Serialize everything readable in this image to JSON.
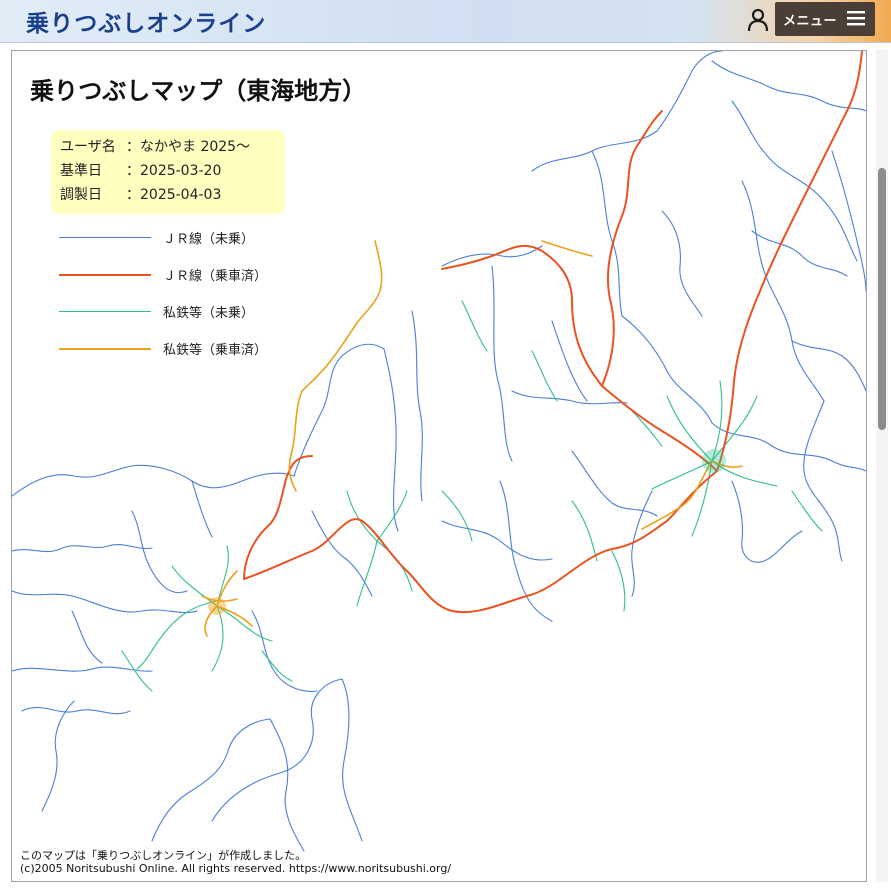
{
  "header": {
    "site_title": "乗りつぶしオンライン",
    "menu_label": "メニュー",
    "user_icon": "user-icon",
    "menu_icon": "hamburger-icon"
  },
  "map": {
    "title": "乗りつぶしマップ（東海地方）",
    "info": {
      "user_key": "ユーザ名",
      "user_value": "：なかやま 2025～",
      "base_key": "基準日",
      "base_value": "：2025-03-20",
      "made_key": "調製日",
      "made_value": "：2025-04-03"
    },
    "legend": [
      {
        "label": "ＪＲ線（未乗）",
        "color": "#4a7fd6"
      },
      {
        "label": "ＪＲ線（乗車済）",
        "color": "#ea5321"
      },
      {
        "label": "私鉄等（未乗）",
        "color": "#2fbf8a"
      },
      {
        "label": "私鉄等（乗車済）",
        "color": "#eaa21a"
      }
    ],
    "credit_line1": "このマップは「乗りつぶしオンライン」が作成しました。",
    "credit_line2": "(c)2005 Noritsubushi Online. All rights reserved. https://www.noritsubushi.org/"
  }
}
